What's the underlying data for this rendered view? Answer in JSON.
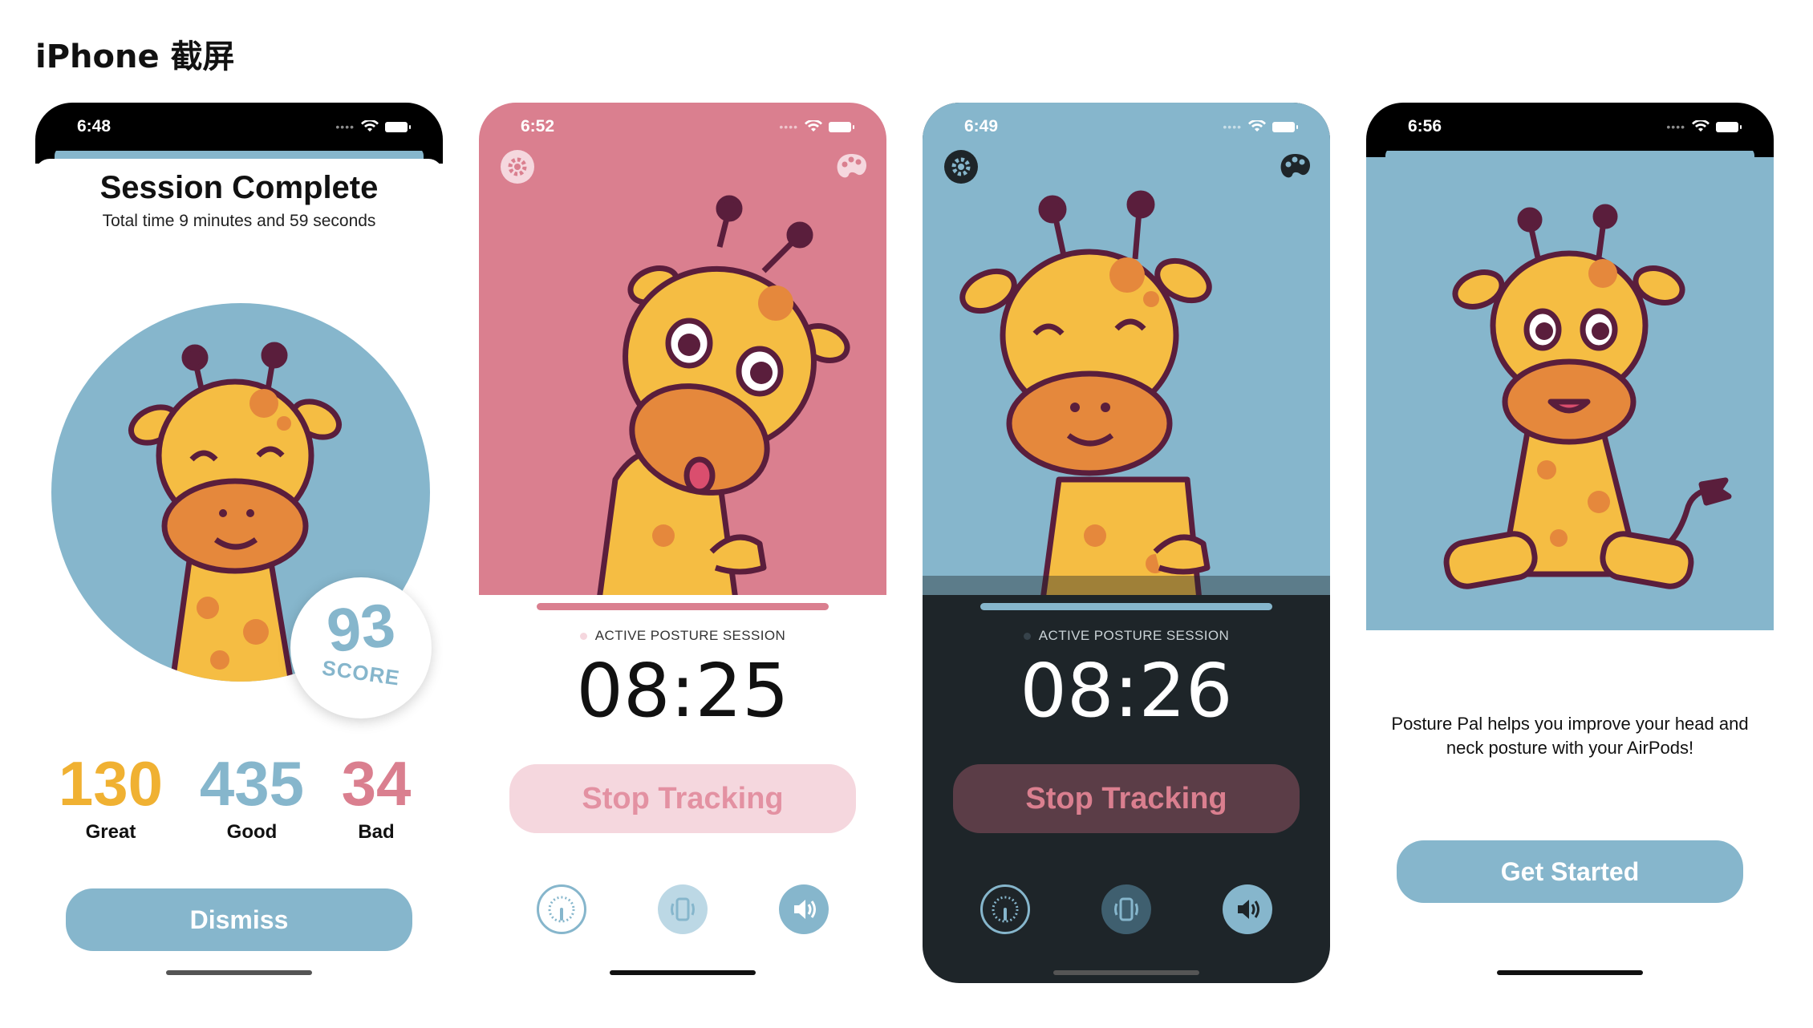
{
  "page": {
    "title": "iPhone 截屏"
  },
  "colors": {
    "blue": "#86b6cc",
    "pink": "#da7f8f",
    "orange": "#f0b132",
    "dark": "#1e2529",
    "pink_light": "#f5d7de"
  },
  "screens": [
    {
      "time": "6:48",
      "title": "Session Complete",
      "subtitle": "Total time 9 minutes and 59 seconds",
      "score": {
        "value": "93",
        "label": "SCORE"
      },
      "stats": [
        {
          "value": "130",
          "label": "Great",
          "color": "#f0b132"
        },
        {
          "value": "435",
          "label": "Good",
          "color": "#86b6cc"
        },
        {
          "value": "34",
          "label": "Bad",
          "color": "#da7f8f"
        }
      ],
      "button": "Dismiss",
      "icons": [
        "giraffe-happy-illustration"
      ]
    },
    {
      "time": "6:52",
      "session_label": "ACTIVE POSTURE SESSION",
      "timer": "08:25",
      "button": "Stop Tracking",
      "icons": [
        "settings-icon",
        "palette-icon",
        "gauge-icon",
        "vibrate-icon",
        "speaker-icon"
      ]
    },
    {
      "time": "6:49",
      "session_label": "ACTIVE POSTURE SESSION",
      "timer": "08:26",
      "button": "Stop Tracking",
      "icons": [
        "settings-icon",
        "palette-icon",
        "gauge-icon",
        "vibrate-icon",
        "speaker-icon"
      ]
    },
    {
      "time": "6:56",
      "description": "Posture Pal helps you improve your head and neck posture with your AirPods!",
      "button": "Get Started",
      "icons": [
        "giraffe-sitting-illustration"
      ]
    }
  ]
}
